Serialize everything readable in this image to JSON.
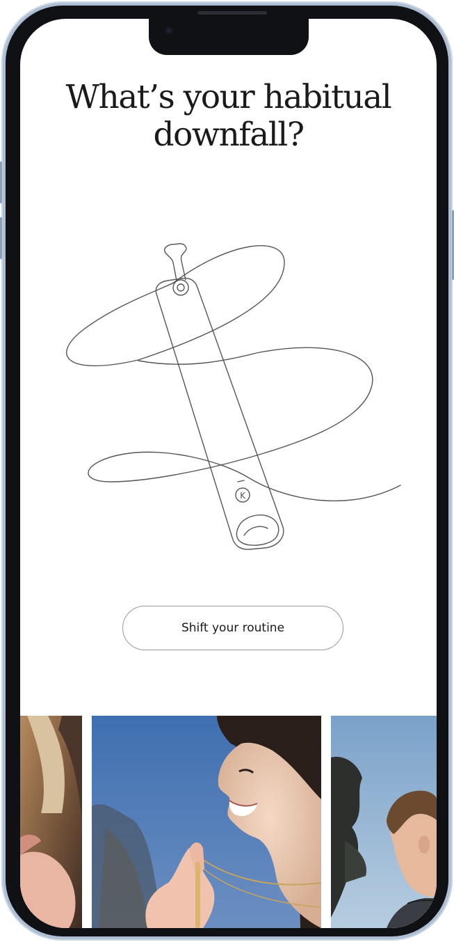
{
  "page": {
    "headline_line1": "What’s your habitual",
    "headline_line2": "downfall?",
    "cta_label": "Shift your routine"
  },
  "colors": {
    "frame": "#aebfd4",
    "bezel": "#101114",
    "text": "#1a1a1a",
    "line_art": "#555555",
    "button_border": "#9a9a9a"
  },
  "illustration": {
    "icon": "necklace-pendant-line-art",
    "pendant_mark": "K"
  },
  "gallery": {
    "photos": [
      {
        "name": "photo-hand-closeup"
      },
      {
        "name": "photo-smiling-woman-necklace"
      },
      {
        "name": "photo-man-outdoors"
      }
    ]
  }
}
